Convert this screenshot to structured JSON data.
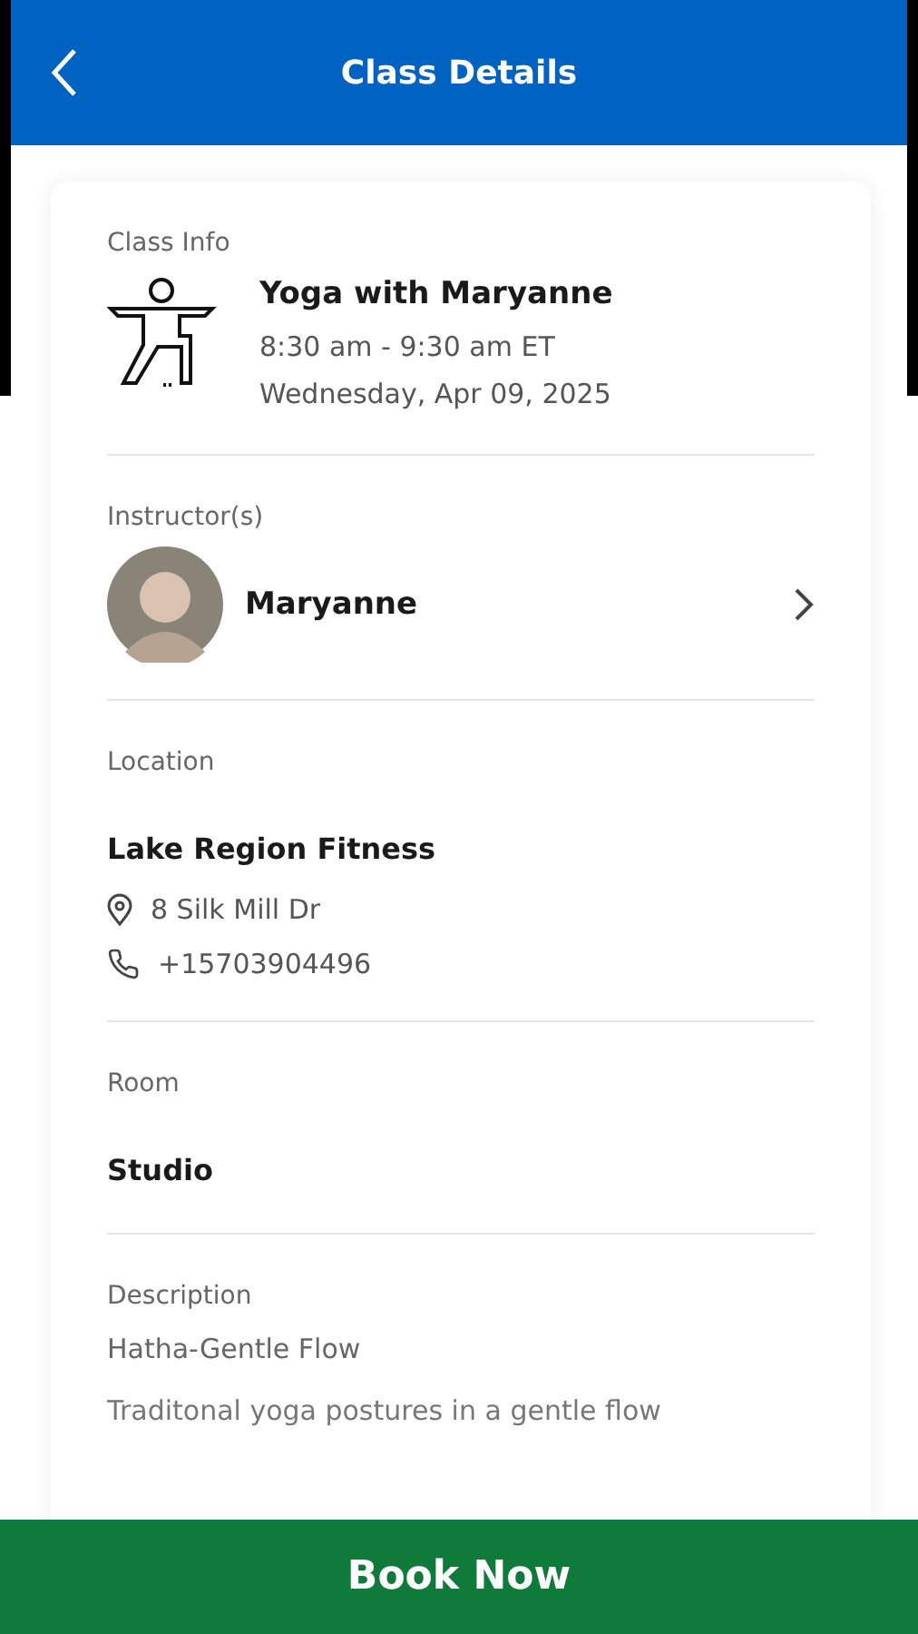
{
  "header": {
    "title": "Class Details"
  },
  "class_info": {
    "label": "Class Info",
    "name": "Yoga with Maryanne",
    "time": "8:30 am - 9:30 am ET",
    "date": "Wednesday, Apr 09, 2025"
  },
  "instructors": {
    "label": "Instructor(s)",
    "items": [
      {
        "name": "Maryanne"
      }
    ]
  },
  "location": {
    "label": "Location",
    "name": "Lake Region Fitness",
    "address": "8 Silk Mill Dr",
    "phone": "+15703904496"
  },
  "room": {
    "label": "Room",
    "name": "Studio"
  },
  "description": {
    "label": "Description",
    "title": "Hatha-Gentle Flow",
    "text": "Traditonal yoga postures in a gentle flow"
  },
  "book_button": "Book Now"
}
